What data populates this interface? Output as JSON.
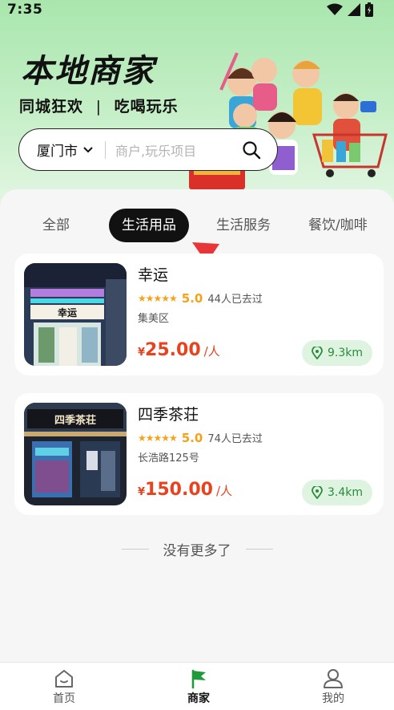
{
  "status_bar": {
    "time": "7:35"
  },
  "hero": {
    "title": "本地商家",
    "subtitle_left": "同城狂欢",
    "subtitle_sep": "|",
    "subtitle_right": "吃喝玩乐"
  },
  "search": {
    "city": "厦门市",
    "placeholder": "商户,玩乐项目"
  },
  "tabs": [
    {
      "label": "全部",
      "active": false
    },
    {
      "label": "生活用品",
      "active": true
    },
    {
      "label": "生活服务",
      "active": false
    },
    {
      "label": "餐饮/咖啡",
      "active": false
    }
  ],
  "merchants": [
    {
      "name": "幸运",
      "rating": "5.0",
      "visits": "44人已去过",
      "address": "集美区",
      "currency": "¥",
      "price": "25.00",
      "unit": "/人",
      "distance": "9.3km",
      "sign_text": "幸运"
    },
    {
      "name": "四季茶荘",
      "rating": "5.0",
      "visits": "74人已去过",
      "address": "长浩路125号",
      "currency": "¥",
      "price": "150.00",
      "unit": "/人",
      "distance": "3.4km",
      "sign_text": "四季茶荘"
    }
  ],
  "footer": {
    "no_more": "没有更多了"
  },
  "bottom_nav": [
    {
      "label": "首页",
      "icon": "home-icon",
      "active": false
    },
    {
      "label": "商家",
      "icon": "flag-icon",
      "active": true
    },
    {
      "label": "我的",
      "icon": "user-icon",
      "active": false
    }
  ],
  "colors": {
    "accent_price": "#e8421f",
    "star": "#f5a21b",
    "distance_bg": "#dff4e0",
    "distance_text": "#2b8a3e",
    "hero_green": "#a9e6ad"
  }
}
